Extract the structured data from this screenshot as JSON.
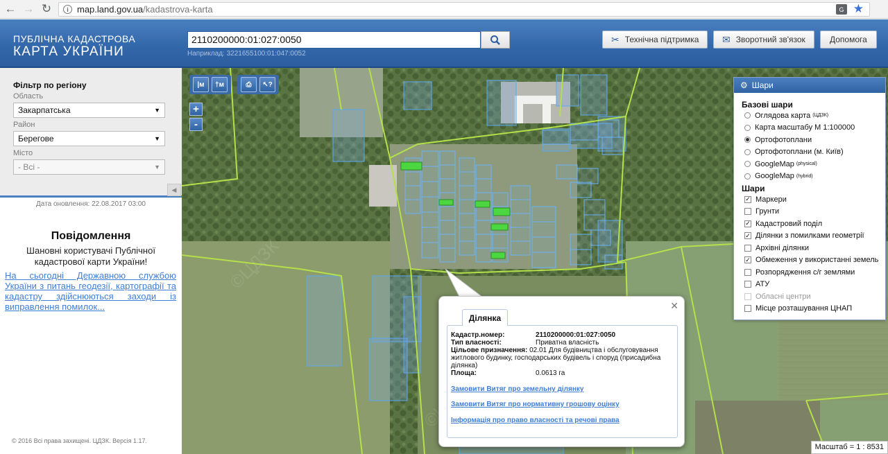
{
  "browser": {
    "url_host": "map.land.gov.ua",
    "url_path": "/kadastrova-karta"
  },
  "header": {
    "brand_line1": "ПУБЛІЧНА КАДАСТРОВА",
    "brand_line2": "КАРТА УКРАЇНИ",
    "search_value": "2110200000:01:027:0050",
    "search_hint": "Наприклад: 3221655100:01:047:0052",
    "buttons": {
      "support": "Технічна підтримка",
      "feedback": "Зворотний зв'язок",
      "help": "Допомога"
    }
  },
  "filter": {
    "title": "Фільтр по регіону",
    "oblast_label": "Область",
    "oblast_value": "Закарпатська",
    "rayon_label": "Район",
    "rayon_value": "Берегове",
    "misto_label": "Місто",
    "misto_value": "- Всі -"
  },
  "sidebar": {
    "updated": "Дата оновлення: 22.08.2017 03:00",
    "notice_title": "Повідомлення",
    "notice_text": "Шановні користувачі Публічної кадастрової карти України!",
    "notice_link": "На сьогодні Державною службою України з питань геодезії, картографії та кадастру здійснюються заходи із виправлення помилок...",
    "footer": "© 2016 Всі права захищені. ЦДЗК. Версія 1.17."
  },
  "map": {
    "zoom_in": "+",
    "zoom_out": "-",
    "scale": "Масштаб = 1 : 8531"
  },
  "layers": {
    "title": "Шари",
    "base_title": "Базові шари",
    "base": [
      {
        "label": "Оглядова карта",
        "sup": "(ЦДЗК)",
        "selected": false
      },
      {
        "label": "Карта масштабу М 1:100000",
        "sup": "",
        "selected": false
      },
      {
        "label": "Ортофотоплани",
        "sup": "",
        "selected": true
      },
      {
        "label": "Ортофотоплани (м. Київ)",
        "sup": "",
        "selected": false
      },
      {
        "label": "GoogleMap",
        "sup": "(physical)",
        "selected": false
      },
      {
        "label": "GoogleMap",
        "sup": "(hybrid)",
        "selected": false
      }
    ],
    "overlay_title": "Шари",
    "overlays": [
      {
        "label": "Маркери",
        "checked": true,
        "disabled": false
      },
      {
        "label": "Грунти",
        "checked": false,
        "disabled": false
      },
      {
        "label": "Кадастровий поділ",
        "checked": true,
        "disabled": false
      },
      {
        "label": "Ділянки з помилками геометрії",
        "checked": true,
        "disabled": false
      },
      {
        "label": "Архівні ділянки",
        "checked": false,
        "disabled": false
      },
      {
        "label": "Обмеження у використанні земель",
        "checked": true,
        "disabled": false
      },
      {
        "label": "Розпорядження с/г землями",
        "checked": false,
        "disabled": false
      },
      {
        "label": "АТУ",
        "checked": false,
        "disabled": false
      },
      {
        "label": "Обласні центри",
        "checked": false,
        "disabled": true
      },
      {
        "label": "Місце розташування ЦНАП",
        "checked": false,
        "disabled": false
      }
    ]
  },
  "popup": {
    "tab": "Ділянка",
    "cadnum_label": "Кадастр.номер:",
    "cadnum_value": "2110200000:01:027:0050",
    "ownership_label": "Тип власності:",
    "ownership_value": "Приватна власність",
    "purpose_label": "Цільове призначення:",
    "purpose_value": "02.01 Для будівництва і обслуговування житлового будинку, господарських будівель і споруд (присадибна ділянка)",
    "area_label": "Площа:",
    "area_value": "0.0613 га",
    "links": [
      "Замовити Витяг про земельну ділянку",
      "Замовити Витяг про нормативну грошову оцінку",
      "Інформація про право власності та речові права"
    ]
  }
}
